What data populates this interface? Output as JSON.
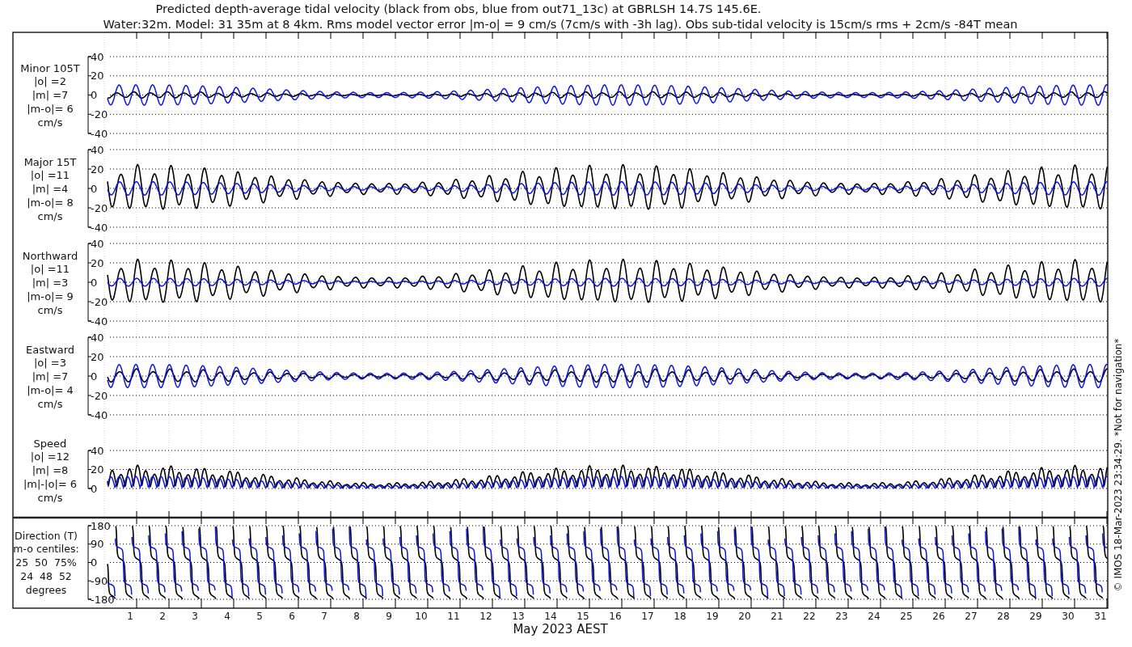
{
  "title_lines": [
    "Predicted depth-average tidal velocity (black from obs, blue from out71_13c) at GBRLSH 14.7S 145.6E.",
    "Water:32m. Model: 31 35m at 8 4km. Rms model vector error |m-o| = 9 cm/s (7cm/s with -3h lag). Obs sub-tidal velocity is 15cm/s rms + 2cm/s -84T mean"
  ],
  "panels": [
    {
      "kind": "minor",
      "label_lines": [
        "Minor 105T",
        "|o| =2",
        "|m| =7",
        "|m-o|= 6",
        "cm/s"
      ],
      "yticks": [
        "40",
        "20",
        "0",
        "-20",
        "-40"
      ]
    },
    {
      "kind": "major",
      "label_lines": [
        "Major 15T",
        "|o| =11",
        "|m| =4",
        "|m-o|= 8",
        "cm/s"
      ],
      "yticks": [
        "40",
        "20",
        "0",
        "-20",
        "-40"
      ]
    },
    {
      "kind": "north",
      "label_lines": [
        "Northward",
        "|o| =11",
        "|m| =3",
        "|m-o|= 9",
        "cm/s"
      ],
      "yticks": [
        "40",
        "20",
        "0",
        "-20",
        "-40"
      ]
    },
    {
      "kind": "east",
      "label_lines": [
        "Eastward",
        "|o| =3",
        "|m| =7",
        "|m-o|= 4",
        "cm/s"
      ],
      "yticks": [
        "40",
        "20",
        "0",
        "-20",
        "-40"
      ]
    },
    {
      "kind": "speed",
      "label_lines": [
        "Speed",
        "|o| =12",
        "|m| =8",
        "|m|-|o|= 6",
        "cm/s"
      ],
      "yticks": [
        "40",
        "20",
        "0"
      ]
    },
    {
      "kind": "direction",
      "label_lines": [
        "Direction (T)",
        "m-o centiles:",
        "25  50  75%",
        "24  48  52",
        "degrees"
      ],
      "yticks": [
        "180",
        "90",
        "0",
        "-90",
        "-180"
      ]
    }
  ],
  "xticks": [
    "1",
    "2",
    "3",
    "4",
    "5",
    "6",
    "7",
    "8",
    "9",
    "10",
    "11",
    "12",
    "13",
    "14",
    "15",
    "16",
    "17",
    "18",
    "19",
    "20",
    "21",
    "22",
    "23",
    "24",
    "25",
    "26",
    "27",
    "28",
    "29",
    "30",
    "31"
  ],
  "xlabel": "May 2023 AEST",
  "footer": "© IMOS 18-Mar-2023 23:34:29. *Not for navigation*"
}
